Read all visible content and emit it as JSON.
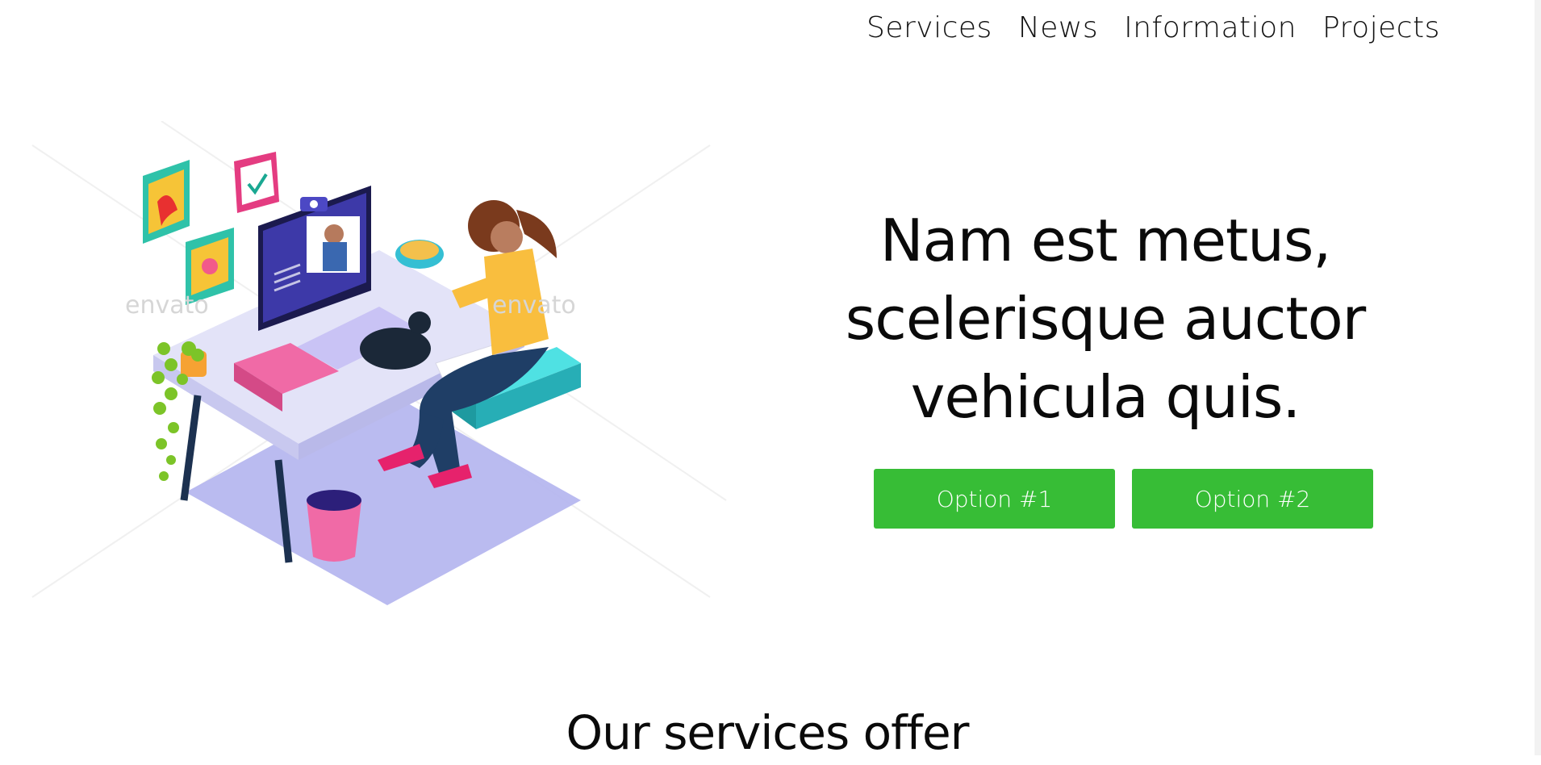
{
  "nav": {
    "items": [
      {
        "label": "Services"
      },
      {
        "label": "News"
      },
      {
        "label": "Information"
      },
      {
        "label": "Projects"
      }
    ]
  },
  "hero": {
    "title_lines": [
      "Nam est metus,",
      "scelerisque auctor",
      "vehicula quis."
    ],
    "buttons": [
      {
        "label": "Option #1"
      },
      {
        "label": "Option #2"
      }
    ],
    "illustration": {
      "subject": "isometric-woman-at-desk-video-call-with-cat",
      "watermark": "envato"
    }
  },
  "services": {
    "title": "Our services offer"
  },
  "colors": {
    "button_green": "#37bd36",
    "text": "#0a0a0a",
    "background": "#ffffff"
  }
}
